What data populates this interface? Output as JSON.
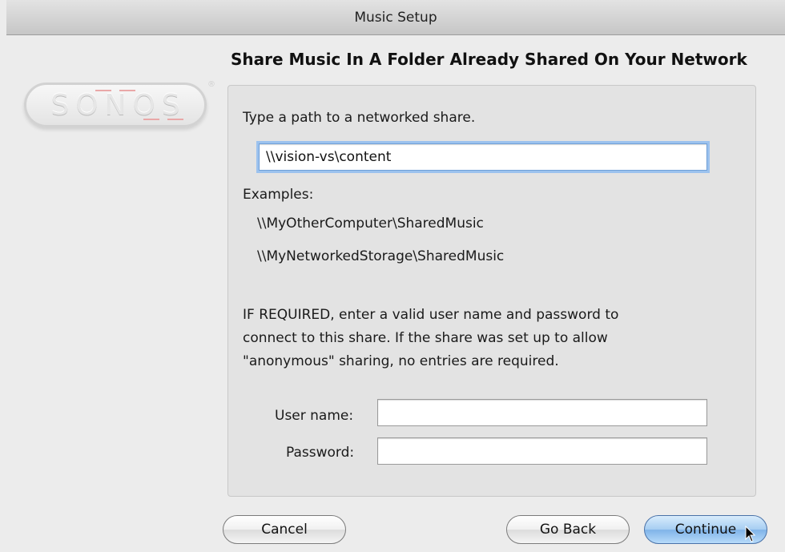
{
  "window": {
    "title": "Music Setup"
  },
  "logo": {
    "text": "SONOS",
    "registered": "®"
  },
  "heading": "Share Music In A Folder Already Shared On Your Network",
  "share": {
    "instruction": "Type a path to a networked share.",
    "path_value": "\\\\vision-vs\\content",
    "examples_label": "Examples:",
    "examples": [
      "\\\\MyOtherComputer\\SharedMusic",
      "\\\\MyNetworkedStorage\\SharedMusic"
    ]
  },
  "credentials": {
    "note_lines": [
      "IF REQUIRED, enter a valid user name and password to",
      "connect to this share. If the share was set up to allow",
      "\"anonymous\" sharing, no entries are required."
    ],
    "username_label": "User name:",
    "username_value": "",
    "password_label": "Password:",
    "password_value": ""
  },
  "buttons": {
    "cancel": "Cancel",
    "go_back": "Go Back",
    "continue": "Continue"
  }
}
